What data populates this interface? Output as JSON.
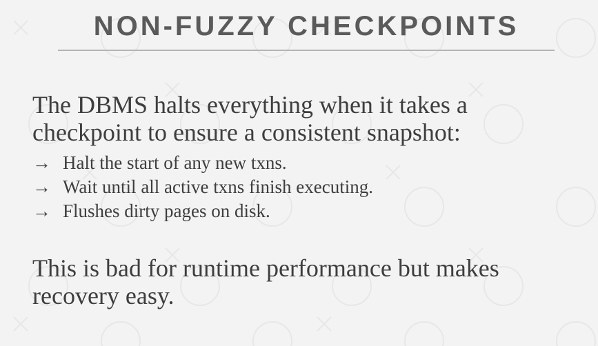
{
  "slide": {
    "title": "NON-FUZZY CHECKPOINTS",
    "paragraph1": {
      "line1": "The DBMS halts everything when it takes a",
      "line2": "checkpoint to ensure a consistent snapshot:"
    },
    "bullets": [
      {
        "arrow": "→",
        "text": "Halt the start of any new txns."
      },
      {
        "arrow": "→",
        "text": "Wait until all active txns finish executing."
      },
      {
        "arrow": "→",
        "text": "Flushes dirty pages on disk."
      }
    ],
    "paragraph2": {
      "line1": "This is bad for runtime performance but makes",
      "line2": "recovery easy."
    }
  },
  "theme": {
    "background": "#f3f3f3",
    "title_color": "#5a5a5a",
    "text_color": "#3e3e3e",
    "rule_color": "#b4b4b4"
  }
}
